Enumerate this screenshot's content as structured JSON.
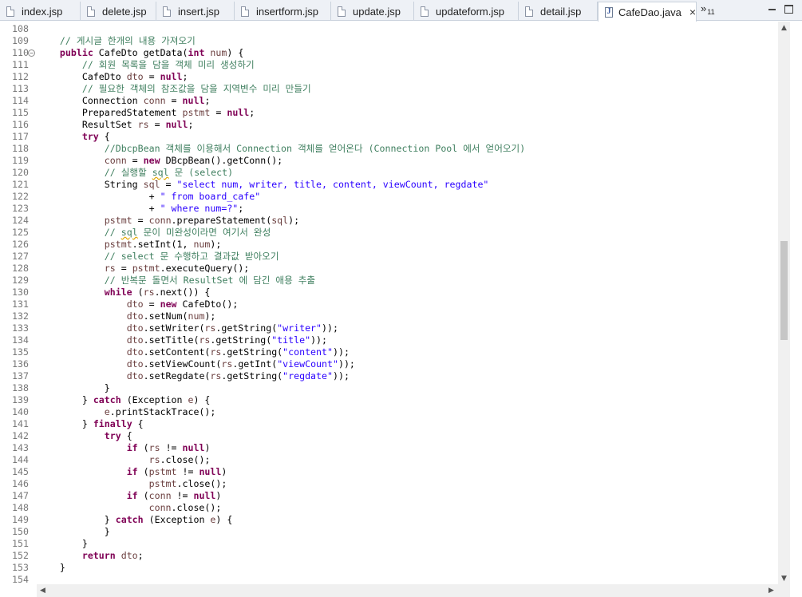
{
  "tabs": [
    {
      "label": "index.jsp",
      "active": false
    },
    {
      "label": "delete.jsp",
      "active": false
    },
    {
      "label": "insert.jsp",
      "active": false
    },
    {
      "label": "insertform.jsp",
      "active": false
    },
    {
      "label": "update.jsp",
      "active": false
    },
    {
      "label": "updateform.jsp",
      "active": false
    },
    {
      "label": "detail.jsp",
      "active": false
    },
    {
      "label": "CafeDao.java",
      "active": true
    }
  ],
  "overflow": {
    "symbol": "»",
    "count": "11"
  },
  "active_tab_close": "×",
  "editor": {
    "lines": [
      {
        "n": "108",
        "segs": []
      },
      {
        "n": "109",
        "segs": [
          [
            "    ",
            ""
          ],
          [
            "// 게시글 한개의 내용 가져오기",
            "cmt"
          ]
        ]
      },
      {
        "n": "110",
        "fold": true,
        "segs": [
          [
            "    ",
            ""
          ],
          [
            "public",
            "kw"
          ],
          [
            " CafeDto getData(",
            ""
          ],
          [
            "int",
            "kw"
          ],
          [
            " ",
            ""
          ],
          [
            "num",
            "var"
          ],
          [
            ") {",
            ""
          ]
        ]
      },
      {
        "n": "111",
        "segs": [
          [
            "        ",
            ""
          ],
          [
            "// 회원 목록을 담을 객체 미리 생성하기",
            "cmt"
          ]
        ]
      },
      {
        "n": "112",
        "segs": [
          [
            "        CafeDto ",
            ""
          ],
          [
            "dto",
            "var"
          ],
          [
            " = ",
            ""
          ],
          [
            "null",
            "kw"
          ],
          [
            ";",
            ""
          ]
        ]
      },
      {
        "n": "113",
        "segs": [
          [
            "        ",
            ""
          ],
          [
            "// 필요한 객체의 참조값을 담을 지역변수 미리 만들기",
            "cmt"
          ]
        ]
      },
      {
        "n": "114",
        "segs": [
          [
            "        Connection ",
            ""
          ],
          [
            "conn",
            "var"
          ],
          [
            " = ",
            ""
          ],
          [
            "null",
            "kw"
          ],
          [
            ";",
            ""
          ]
        ]
      },
      {
        "n": "115",
        "segs": [
          [
            "        PreparedStatement ",
            ""
          ],
          [
            "pstmt",
            "var"
          ],
          [
            " = ",
            ""
          ],
          [
            "null",
            "kw"
          ],
          [
            ";",
            ""
          ]
        ]
      },
      {
        "n": "116",
        "segs": [
          [
            "        ResultSet ",
            ""
          ],
          [
            "rs",
            "var"
          ],
          [
            " = ",
            ""
          ],
          [
            "null",
            "kw"
          ],
          [
            ";",
            ""
          ]
        ]
      },
      {
        "n": "117",
        "segs": [
          [
            "        ",
            ""
          ],
          [
            "try",
            "kw"
          ],
          [
            " {",
            ""
          ]
        ]
      },
      {
        "n": "118",
        "segs": [
          [
            "            ",
            ""
          ],
          [
            "//DbcpBean 객체를 이용해서 Connection 객체를 얻어온다 (Connection Pool 에서 얻어오기)",
            "cmt"
          ]
        ]
      },
      {
        "n": "119",
        "segs": [
          [
            "            ",
            ""
          ],
          [
            "conn",
            "var"
          ],
          [
            " = ",
            ""
          ],
          [
            "new",
            "kw"
          ],
          [
            " DBcpBean().getConn();",
            ""
          ]
        ]
      },
      {
        "n": "120",
        "segs": [
          [
            "            ",
            ""
          ],
          [
            "// 실행할 ",
            "cmt"
          ],
          [
            "sql",
            "cmt squig"
          ],
          [
            " 문 (select)",
            "cmt"
          ]
        ]
      },
      {
        "n": "121",
        "segs": [
          [
            "            String ",
            ""
          ],
          [
            "sql",
            "var"
          ],
          [
            " = ",
            ""
          ],
          [
            "\"select num, writer, title, content, viewCount, regdate\"",
            "str"
          ]
        ]
      },
      {
        "n": "122",
        "segs": [
          [
            "                    + ",
            ""
          ],
          [
            "\" from board_cafe\"",
            "str"
          ]
        ]
      },
      {
        "n": "123",
        "segs": [
          [
            "                    + ",
            ""
          ],
          [
            "\" where num=?\"",
            "str"
          ],
          [
            ";",
            ""
          ]
        ]
      },
      {
        "n": "124",
        "segs": [
          [
            "            ",
            ""
          ],
          [
            "pstmt",
            "var"
          ],
          [
            " = ",
            ""
          ],
          [
            "conn",
            "var"
          ],
          [
            ".prepareStatement(",
            ""
          ],
          [
            "sql",
            "var"
          ],
          [
            ");",
            ""
          ]
        ]
      },
      {
        "n": "125",
        "segs": [
          [
            "            ",
            ""
          ],
          [
            "// ",
            "cmt"
          ],
          [
            "sql",
            "cmt squig"
          ],
          [
            " 문이 미완성이라면 여기서 완성",
            "cmt"
          ]
        ]
      },
      {
        "n": "126",
        "segs": [
          [
            "            ",
            ""
          ],
          [
            "pstmt",
            "var"
          ],
          [
            ".setInt(1, ",
            ""
          ],
          [
            "num",
            "var"
          ],
          [
            ");",
            ""
          ]
        ]
      },
      {
        "n": "127",
        "segs": [
          [
            "            ",
            ""
          ],
          [
            "// select 문 수행하고 결과값 받아오기",
            "cmt"
          ]
        ]
      },
      {
        "n": "128",
        "segs": [
          [
            "            ",
            ""
          ],
          [
            "rs",
            "var"
          ],
          [
            " = ",
            ""
          ],
          [
            "pstmt",
            "var"
          ],
          [
            ".executeQuery();",
            ""
          ]
        ]
      },
      {
        "n": "129",
        "segs": [
          [
            "            ",
            ""
          ],
          [
            "// 반복문 돌면서 ResultSet 에 담긴 애용 추출",
            "cmt"
          ]
        ]
      },
      {
        "n": "130",
        "segs": [
          [
            "            ",
            ""
          ],
          [
            "while",
            "kw"
          ],
          [
            " (",
            ""
          ],
          [
            "rs",
            "var"
          ],
          [
            ".next()) {",
            ""
          ]
        ]
      },
      {
        "n": "131",
        "segs": [
          [
            "                ",
            ""
          ],
          [
            "dto",
            "var"
          ],
          [
            " = ",
            ""
          ],
          [
            "new",
            "kw"
          ],
          [
            " CafeDto();",
            ""
          ]
        ]
      },
      {
        "n": "132",
        "segs": [
          [
            "                ",
            ""
          ],
          [
            "dto",
            "var"
          ],
          [
            ".setNum(",
            ""
          ],
          [
            "num",
            "var"
          ],
          [
            ");",
            ""
          ]
        ]
      },
      {
        "n": "133",
        "segs": [
          [
            "                ",
            ""
          ],
          [
            "dto",
            "var"
          ],
          [
            ".setWriter(",
            ""
          ],
          [
            "rs",
            "var"
          ],
          [
            ".getString(",
            ""
          ],
          [
            "\"writer\"",
            "str"
          ],
          [
            "));",
            ""
          ]
        ]
      },
      {
        "n": "134",
        "segs": [
          [
            "                ",
            ""
          ],
          [
            "dto",
            "var"
          ],
          [
            ".setTitle(",
            ""
          ],
          [
            "rs",
            "var"
          ],
          [
            ".getString(",
            ""
          ],
          [
            "\"title\"",
            "str"
          ],
          [
            "));",
            ""
          ]
        ]
      },
      {
        "n": "135",
        "segs": [
          [
            "                ",
            ""
          ],
          [
            "dto",
            "var"
          ],
          [
            ".setContent(",
            ""
          ],
          [
            "rs",
            "var"
          ],
          [
            ".getString(",
            ""
          ],
          [
            "\"content\"",
            "str"
          ],
          [
            "));",
            ""
          ]
        ]
      },
      {
        "n": "136",
        "segs": [
          [
            "                ",
            ""
          ],
          [
            "dto",
            "var"
          ],
          [
            ".setViewCount(",
            ""
          ],
          [
            "rs",
            "var"
          ],
          [
            ".getInt(",
            ""
          ],
          [
            "\"viewCount\"",
            "str"
          ],
          [
            "));",
            ""
          ]
        ]
      },
      {
        "n": "137",
        "segs": [
          [
            "                ",
            ""
          ],
          [
            "dto",
            "var"
          ],
          [
            ".setRegdate(",
            ""
          ],
          [
            "rs",
            "var"
          ],
          [
            ".getString(",
            ""
          ],
          [
            "\"regdate\"",
            "str"
          ],
          [
            "));",
            ""
          ]
        ]
      },
      {
        "n": "138",
        "segs": [
          [
            "            }",
            ""
          ]
        ]
      },
      {
        "n": "139",
        "segs": [
          [
            "        } ",
            ""
          ],
          [
            "catch",
            "kw"
          ],
          [
            " (Exception ",
            ""
          ],
          [
            "e",
            "var"
          ],
          [
            ") {",
            ""
          ]
        ]
      },
      {
        "n": "140",
        "segs": [
          [
            "            ",
            ""
          ],
          [
            "e",
            "var"
          ],
          [
            ".printStackTrace();",
            ""
          ]
        ]
      },
      {
        "n": "141",
        "segs": [
          [
            "        } ",
            ""
          ],
          [
            "finally",
            "kw"
          ],
          [
            " {",
            ""
          ]
        ]
      },
      {
        "n": "142",
        "segs": [
          [
            "            ",
            ""
          ],
          [
            "try",
            "kw"
          ],
          [
            " {",
            ""
          ]
        ]
      },
      {
        "n": "143",
        "segs": [
          [
            "                ",
            ""
          ],
          [
            "if",
            "kw"
          ],
          [
            " (",
            ""
          ],
          [
            "rs",
            "var"
          ],
          [
            " != ",
            ""
          ],
          [
            "null",
            "kw"
          ],
          [
            ")",
            ""
          ]
        ]
      },
      {
        "n": "144",
        "segs": [
          [
            "                    ",
            ""
          ],
          [
            "rs",
            "var"
          ],
          [
            ".close();",
            ""
          ]
        ]
      },
      {
        "n": "145",
        "segs": [
          [
            "                ",
            ""
          ],
          [
            "if",
            "kw"
          ],
          [
            " (",
            ""
          ],
          [
            "pstmt",
            "var"
          ],
          [
            " != ",
            ""
          ],
          [
            "null",
            "kw"
          ],
          [
            ")",
            ""
          ]
        ]
      },
      {
        "n": "146",
        "segs": [
          [
            "                    ",
            ""
          ],
          [
            "pstmt",
            "var"
          ],
          [
            ".close();",
            ""
          ]
        ]
      },
      {
        "n": "147",
        "segs": [
          [
            "                ",
            ""
          ],
          [
            "if",
            "kw"
          ],
          [
            " (",
            ""
          ],
          [
            "conn",
            "var"
          ],
          [
            " != ",
            ""
          ],
          [
            "null",
            "kw"
          ],
          [
            ")",
            ""
          ]
        ]
      },
      {
        "n": "148",
        "segs": [
          [
            "                    ",
            ""
          ],
          [
            "conn",
            "var"
          ],
          [
            ".close();",
            ""
          ]
        ]
      },
      {
        "n": "149",
        "segs": [
          [
            "            } ",
            ""
          ],
          [
            "catch",
            "kw"
          ],
          [
            " (Exception ",
            ""
          ],
          [
            "e",
            "var"
          ],
          [
            ") {",
            ""
          ]
        ]
      },
      {
        "n": "150",
        "segs": [
          [
            "            }",
            ""
          ]
        ]
      },
      {
        "n": "151",
        "segs": [
          [
            "        }",
            ""
          ]
        ]
      },
      {
        "n": "152",
        "segs": [
          [
            "        ",
            ""
          ],
          [
            "return",
            "kw"
          ],
          [
            " ",
            ""
          ],
          [
            "dto",
            "var"
          ],
          [
            ";",
            ""
          ]
        ]
      },
      {
        "n": "153",
        "segs": [
          [
            "    }",
            ""
          ]
        ]
      },
      {
        "n": "154",
        "segs": []
      }
    ]
  },
  "scroll": {
    "vertical_position_fraction": 0.4
  }
}
